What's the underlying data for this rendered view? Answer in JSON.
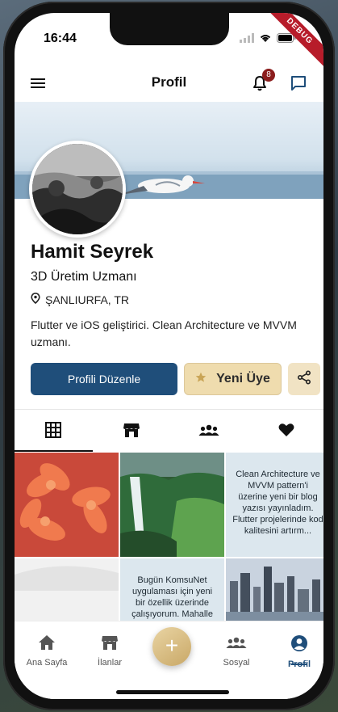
{
  "status_bar": {
    "time": "16:44",
    "debug_label": "DEBUG"
  },
  "app_bar": {
    "title": "Profil",
    "notification_count": "8"
  },
  "profile": {
    "name": "Hamit Seyrek",
    "job_title": "3D Üretim Uzmanı",
    "location": "ŞANLIURFA, TR",
    "bio": "Flutter ve iOS geliştirici. Clean Architecture ve MVVM uzmanı."
  },
  "actions": {
    "edit_label": "Profili Düzenle",
    "member_label": "Yeni Üye"
  },
  "tabs": [
    {
      "icon": "grid-icon"
    },
    {
      "icon": "store-icon"
    },
    {
      "icon": "group-icon"
    },
    {
      "icon": "heart-icon"
    }
  ],
  "posts": {
    "text_post_1": "Clean Architecture ve MVVM pattern'i üzerine yeni bir blog yazısı yayınladım. Flutter projelerinde kod kalitesini artırm...",
    "text_post_2": "Bugün KomsuNet uygulaması için yeni bir özellik üzerinde çalışıyorum. Mahalle"
  },
  "bottom_nav": {
    "home": "Ana Sayfa",
    "listings": "İlanlar",
    "social": "Sosyal",
    "profile": "Profil"
  },
  "colors": {
    "primary": "#1f4e7a",
    "gold": "#efdcae",
    "badge": "#8b1d1d",
    "text_post_bg": "#dce7ee"
  }
}
